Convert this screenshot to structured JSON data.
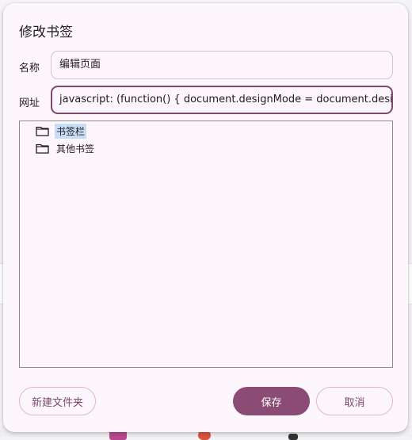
{
  "dialog": {
    "title": "修改书签",
    "name_label": "名称",
    "name_value": "编辑页面",
    "url_label": "网址",
    "url_value": "javascript: (function() { document.designMode = document.designMode"
  },
  "folders": [
    {
      "label": "书签栏",
      "selected": true,
      "icon": "folder-icon"
    },
    {
      "label": "其他书签",
      "selected": false,
      "icon": "folder-icon"
    }
  ],
  "buttons": {
    "new_folder": "新建文件夹",
    "save": "保存",
    "cancel": "取消"
  },
  "colors": {
    "accent": "#8a4b75",
    "selection": "#c7dcf5",
    "dialog_bg": "#fdf7fd"
  }
}
